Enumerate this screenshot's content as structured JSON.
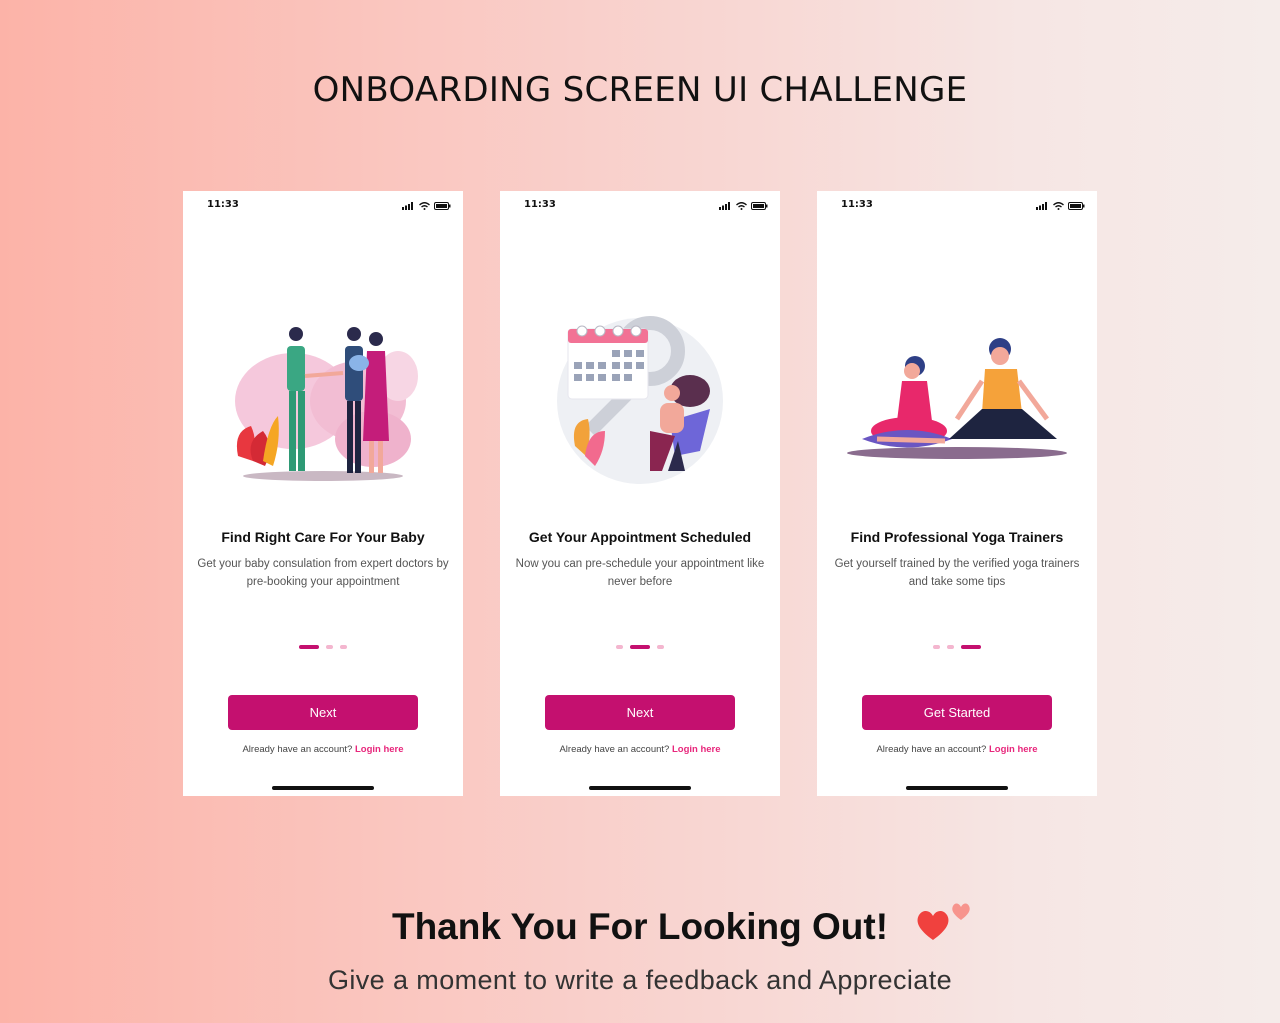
{
  "page": {
    "title": "ONBOARDING SCREEN UI CHALLENGE",
    "thanks": "Thank You For Looking Out!",
    "subline": "Give a moment to write a feedback and Appreciate"
  },
  "colors": {
    "primary": "#c4106f",
    "link": "#e8277c",
    "dot_inactive": "#f4b6cf"
  },
  "screens": [
    {
      "time": "11:33",
      "illustration": "doctor-family-icon",
      "title": "Find  Right Care For Your Baby",
      "description": "Get your baby consulation from expert doctors by pre-booking your appointment",
      "active_dot": 0,
      "button": "Next",
      "login_prompt": "Already have an account?",
      "login_link": "Login here"
    },
    {
      "time": "11:33",
      "illustration": "calendar-appointment-icon",
      "title": "Get Your Appointment Scheduled",
      "description": "Now you can pre-schedule your appointment like never before",
      "active_dot": 1,
      "button": "Next",
      "login_prompt": "Already have an account?",
      "login_link": "Login here"
    },
    {
      "time": "11:33",
      "illustration": "yoga-trainers-icon",
      "title": "Find Professional Yoga Trainers",
      "description": "Get yourself trained by the verified yoga trainers and take some tips",
      "active_dot": 2,
      "button": "Get Started",
      "login_prompt": "Already have an account?",
      "login_link": "Login here"
    }
  ]
}
